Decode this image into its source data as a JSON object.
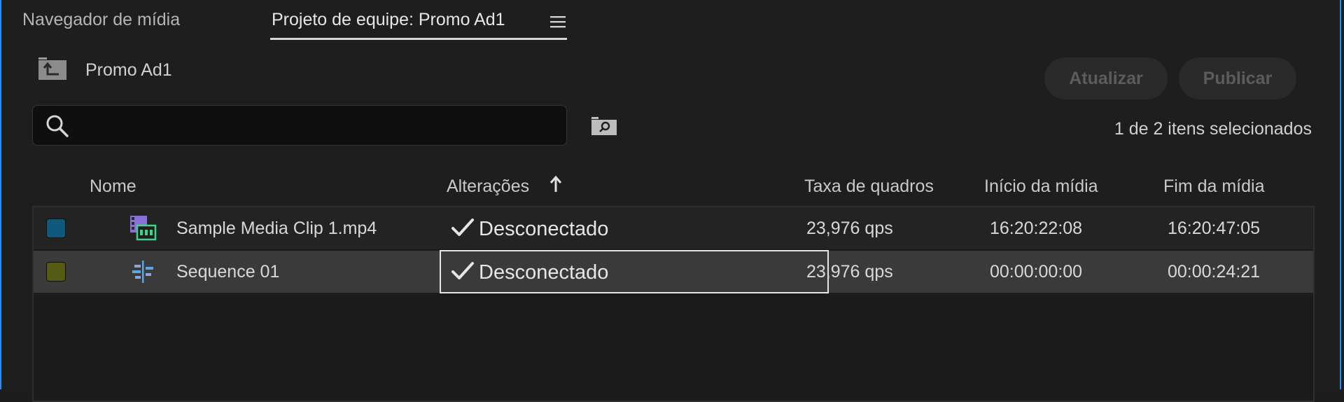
{
  "tabs": {
    "media_browser": "Navegador de mídia",
    "team_project": "Projeto de equipe: Promo Ad1"
  },
  "breadcrumb": {
    "label": "Promo Ad1"
  },
  "toolbar": {
    "update_label": "Atualizar",
    "publish_label": "Publicar",
    "selection_status": "1 de 2 itens selecionados"
  },
  "search": {
    "value": "",
    "placeholder": ""
  },
  "columns": {
    "name": "Nome",
    "changes": "Alterações",
    "frame_rate": "Taxa de quadros",
    "media_start": "Início da mídia",
    "media_end": "Fim da mídia"
  },
  "rows": [
    {
      "label_color": "#0f5a7a",
      "icon": "video-clip-icon",
      "name": "Sample Media Clip 1.mp4",
      "changes": "Desconectado",
      "frame_rate": "23,976 qps",
      "media_start": "16:20:22:08",
      "media_end": "16:20:47:05"
    },
    {
      "label_color": "#555a12",
      "icon": "sequence-icon",
      "name": "Sequence 01",
      "changes": "Desconectado",
      "frame_rate": "23,976 qps",
      "media_start": "00:00:00:00",
      "media_end": "00:00:24:21"
    }
  ],
  "colors": {
    "panel_border": "#2d8ceb",
    "background": "#1e1e1e",
    "selected_row": "#3a3a3a"
  }
}
